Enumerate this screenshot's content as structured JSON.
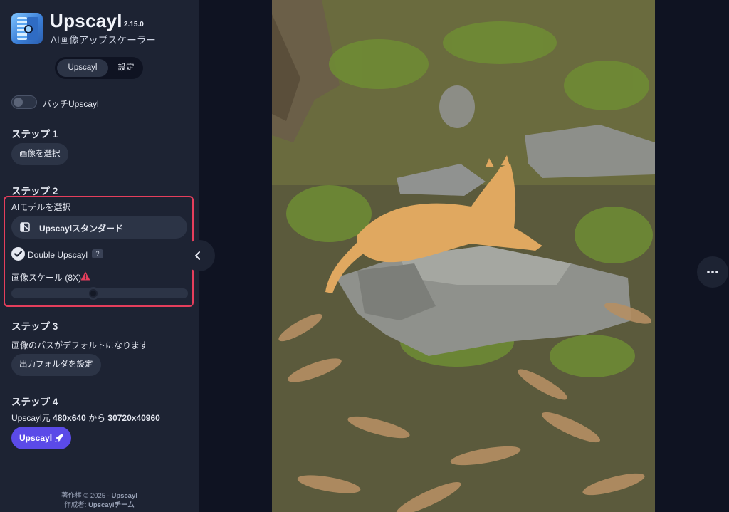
{
  "app": {
    "title": "Upscayl",
    "version": "2.15.0",
    "subtitle": "AI画像アップスケーラー"
  },
  "tabs": [
    {
      "label": "Upscayl",
      "active": true
    },
    {
      "label": "設定",
      "active": false
    }
  ],
  "batch": {
    "label": "バッチUpscayl",
    "enabled": false
  },
  "step1": {
    "heading": "ステップ 1",
    "button_label": "画像を選択"
  },
  "step2": {
    "heading": "ステップ 2",
    "model_label": "AIモデルを選択",
    "model_value": "Upscaylスタンダード",
    "double_upscayl_label": "Double Upscayl",
    "double_upscayl_checked": true,
    "help_label": "?",
    "scale_label": "画像スケール (8X)",
    "scale_value": 8
  },
  "step3": {
    "heading": "ステップ 3",
    "note": "画像のパスがデフォルトになります",
    "button_label": "出力フォルダを設定"
  },
  "step4": {
    "heading": "ステップ 4",
    "text_prefix": "Upscayl元 ",
    "from_size": "480x640",
    "text_mid": " から ",
    "to_size": "30720x40960",
    "button_label": "Upscayl"
  },
  "footer": {
    "copyright_prefix": "著作権 © 2025 - ",
    "copyright_name": "Upscayl",
    "author_prefix": "作成者: ",
    "author_name": "Upscaylチーム"
  },
  "colors": {
    "sidebar_bg": "#1d2333",
    "page_bg": "#0f1322",
    "accent": "#5b4ae8",
    "highlight_border": "#e53e5c"
  },
  "icons": {
    "collapse": "chevron-left-icon",
    "more": "more-horizontal-icon",
    "model": "model-icon",
    "warning": "warning-icon",
    "rocket": "rocket-icon",
    "check": "check-icon"
  }
}
